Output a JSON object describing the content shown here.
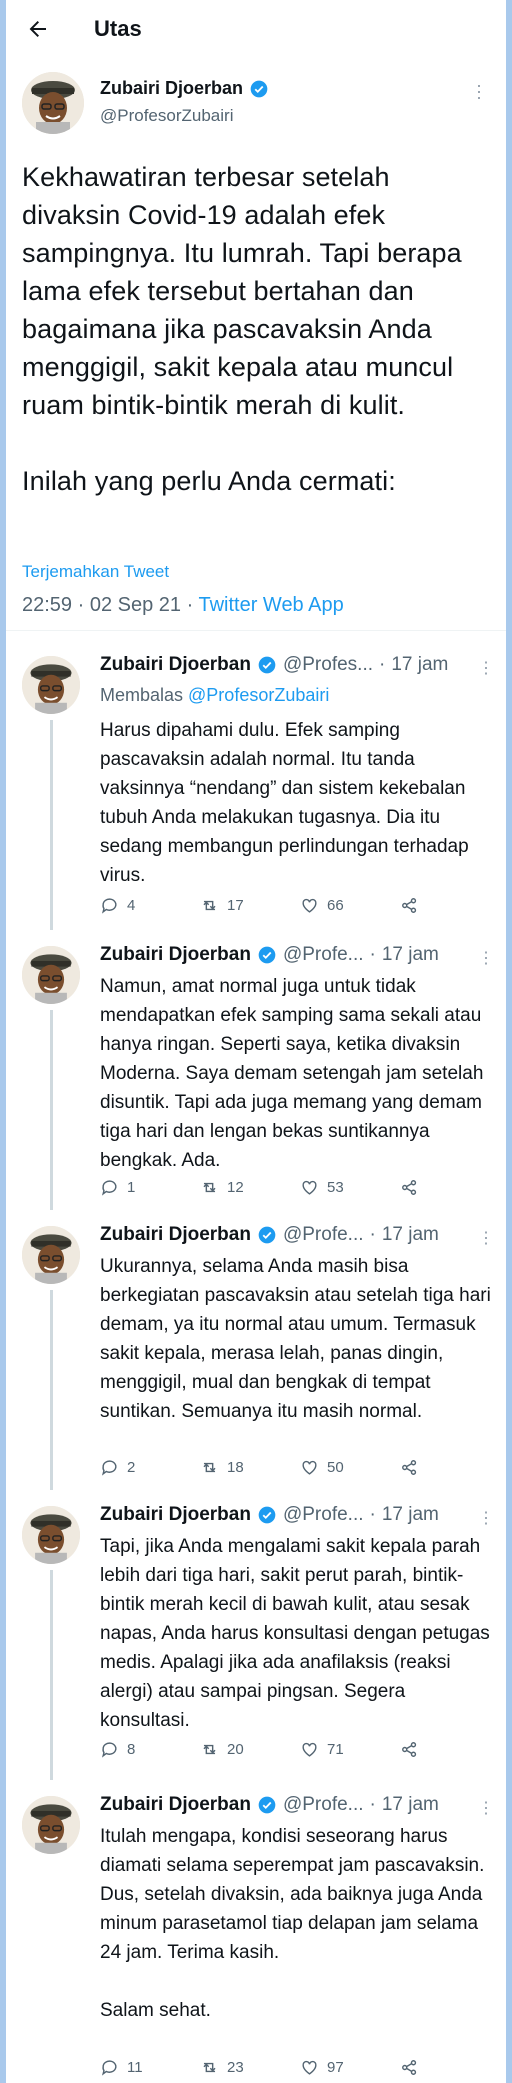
{
  "header": {
    "title": "Utas"
  },
  "main": {
    "name": "Zubairi Djoerban",
    "handle": "@ProfesorZubairi",
    "paragraph1": "Kekhawatiran terbesar setelah divaksin Covid-19 adalah efek sampingnya. Itu lumrah. Tapi berapa lama efek tersebut bertahan dan bagaimana jika pascavaksin Anda menggigil, sakit kepala atau muncul ruam bintik-bintik merah di kulit.",
    "paragraph2": "Inilah yang perlu Anda cermati:",
    "translate": "Terjemahkan Tweet",
    "time": "22:59",
    "date": "02 Sep 21",
    "app": "Twitter Web App"
  },
  "replies": [
    {
      "name": "Zubairi Djoerban",
      "handle": "@Profes...",
      "time": "17 jam",
      "replying_prefix": "Membalas ",
      "replying_to": "@ProfesorZubairi",
      "text": "Harus dipahami dulu. Efek samping pascavaksin adalah normal. Itu tanda vaksinnya “nendang” dan sistem kekebalan tubuh Anda melakukan tugasnya. Dia itu sedang membangun perlindungan terhadap virus.",
      "replies": "4",
      "retweets": "17",
      "likes": "66"
    },
    {
      "name": "Zubairi Djoerban",
      "handle": "@Profe...",
      "time": "17 jam",
      "text": "Namun, amat normal juga untuk tidak mendapatkan efek samping sama sekali atau hanya ringan. Seperti saya, ketika divaksin Moderna. Saya demam setengah jam setelah disuntik. Tapi ada juga memang yang demam tiga hari dan lengan bekas suntikannya bengkak. Ada.",
      "replies": "1",
      "retweets": "12",
      "likes": "53"
    },
    {
      "name": "Zubairi Djoerban",
      "handle": "@Profe...",
      "time": "17 jam",
      "text": "Ukurannya, selama Anda masih bisa berkegiatan pascavaksin atau setelah tiga hari demam, ya itu normal atau umum. Termasuk sakit kepala, merasa lelah, panas dingin, menggigil, mual dan bengkak di tempat suntikan. Semuanya itu masih normal.",
      "replies": "2",
      "retweets": "18",
      "likes": "50"
    },
    {
      "name": "Zubairi Djoerban",
      "handle": "@Profe...",
      "time": "17 jam",
      "text": "Tapi, jika Anda mengalami sakit kepala parah lebih dari tiga hari, sakit perut parah, bintik-bintik merah kecil di bawah kulit, atau sesak napas, Anda harus konsultasi dengan petugas medis. Apalagi jika ada anafilaksis (reaksi alergi) atau sampai pingsan. Segera konsultasi.",
      "replies": "8",
      "retweets": "20",
      "likes": "71"
    },
    {
      "name": "Zubairi Djoerban",
      "handle": "@Profe...",
      "time": "17 jam",
      "text": "Itulah mengapa, kondisi seseorang harus diamati selama seperempat jam pascavaksin. Dus, setelah divaksin, ada baiknya juga Anda minum parasetamol tiap delapan jam selama 24 jam. Terima kasih.\n\nSalam sehat.",
      "replies": "11",
      "retweets": "23",
      "likes": "97"
    }
  ],
  "colors": {
    "accent": "#1d9bf0",
    "muted": "#536471",
    "text": "#0f1419",
    "background": "#a9c9ec"
  },
  "icons": [
    "back-arrow-icon",
    "verified-badge-icon",
    "more-icon",
    "reply-icon",
    "retweet-icon",
    "like-icon",
    "share-icon"
  ]
}
